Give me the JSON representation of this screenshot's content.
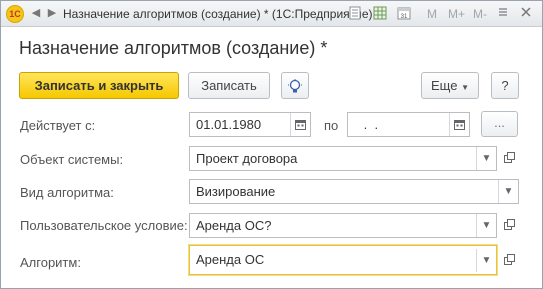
{
  "window": {
    "title": "Назначение алгоритмов (создание) * (1С:Предприятие)",
    "toolbar_m": "M",
    "toolbar_mplus": "M+",
    "toolbar_mminus": "M-"
  },
  "form": {
    "title": "Назначение алгоритмов (создание) *",
    "buttons": {
      "save_close": "Записать и закрыть",
      "save": "Записать",
      "more": "Еще",
      "help": "?"
    },
    "fields": {
      "valid_from_label": "Действует с:",
      "valid_from_value": "01.01.1980",
      "to_label": "по",
      "to_value": " .  .",
      "ellipsis": "...",
      "system_object_label": "Объект системы:",
      "system_object_value": "Проект договора",
      "algorithm_type_label": "Вид алгоритма:",
      "algorithm_type_value": "Визирование",
      "user_condition_label": "Пользовательское условие:",
      "user_condition_value": "Аренда ОС?",
      "algorithm_label": "Алгоритм:",
      "algorithm_value": "Аренда ОС"
    }
  }
}
